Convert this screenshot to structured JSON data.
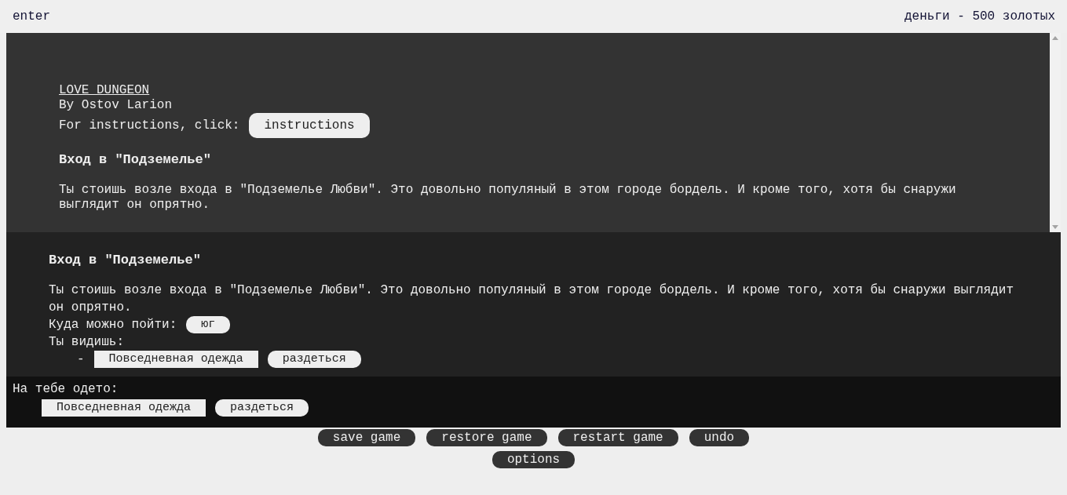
{
  "top_bar": {
    "location": "enter",
    "money": "деньги - 500 золотых"
  },
  "intro": {
    "title": "LOVE DUNGEON",
    "author": "By Ostov Larion",
    "instructions_label": "For instructions, click:",
    "instructions_button": "instructions",
    "heading": "Вход в \"Подземелье\"",
    "description": "Ты стоишь возле входа в \"Подземелье Любви\". Это довольно популяный в этом городе бордель. И кроме того, хотя бы снаружи выглядит он опрятно."
  },
  "room": {
    "heading": "Вход в \"Подземелье\"",
    "description": "Ты стоишь возле входа в \"Подземелье Любви\". Это довольно популяный в этом городе бордель. И кроме того, хотя бы снаружи выглядит он опрятно.",
    "exits_label": "Куда можно пойти:",
    "exits": [
      "юг"
    ],
    "objects_label": "Ты видишь:",
    "objects": [
      {
        "bullet": "-",
        "name": "Повседневная одежда",
        "action": "раздеться"
      }
    ]
  },
  "inventory": {
    "label": "На тебе одето:",
    "items": [
      {
        "name": "Повседневная одежда",
        "action": "раздеться"
      }
    ]
  },
  "buttons": [
    [
      "save game",
      "restore game",
      "restart game",
      "undo"
    ],
    [
      "options"
    ]
  ]
}
